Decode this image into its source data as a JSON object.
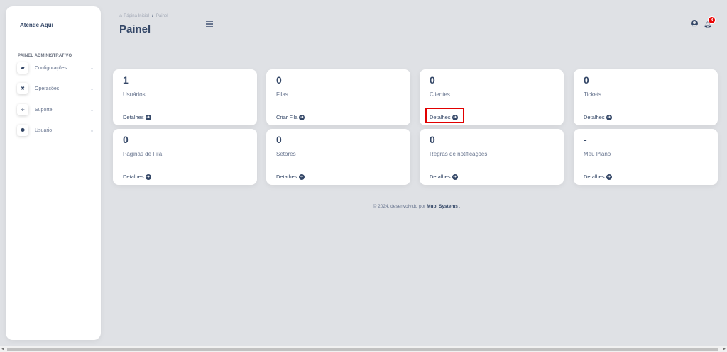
{
  "sidebar": {
    "brand": "Atende Aqui",
    "section_title": "PAINEL ADMINISTRATIVO",
    "items": [
      {
        "label": "Configurações",
        "icon": "briefcase-icon",
        "glyph": "▰"
      },
      {
        "label": "Operações",
        "icon": "tools-icon",
        "glyph": "✖"
      },
      {
        "label": "Suporte",
        "icon": "rocket-icon",
        "glyph": "✈"
      },
      {
        "label": "Usuario",
        "icon": "users-icon",
        "glyph": "⚉"
      }
    ],
    "chevron": "⌄"
  },
  "header": {
    "breadcrumb": {
      "home": "Página Inicial",
      "separator": "/",
      "current": "Painel"
    },
    "title": "Painel",
    "notification_count": "8"
  },
  "cards": [
    {
      "number": "1",
      "label": "Usuários",
      "link": "Detalhes"
    },
    {
      "number": "0",
      "label": "Filas",
      "link": "Criar Fila"
    },
    {
      "number": "0",
      "label": "Clientes",
      "link": "Detalhes"
    },
    {
      "number": "0",
      "label": "Tickets",
      "link": "Detalhes"
    },
    {
      "number": "0",
      "label": "Páginas de Fila",
      "link": "Detalhes"
    },
    {
      "number": "0",
      "label": "Setores",
      "link": "Detalhes"
    },
    {
      "number": "0",
      "label": "Regras de notificações",
      "link": "Detalhes"
    },
    {
      "number": "-",
      "label": "Meu Plano",
      "link": "Detalhes"
    }
  ],
  "footer": {
    "prefix": "© 2024, desenvolvido por",
    "company": "Mupi Systems",
    "suffix": "."
  },
  "colors": {
    "background": "#dfe1e5",
    "text_primary": "#344767",
    "text_muted": "#67748e",
    "badge": "#ea0606",
    "highlight": "#e10000"
  }
}
